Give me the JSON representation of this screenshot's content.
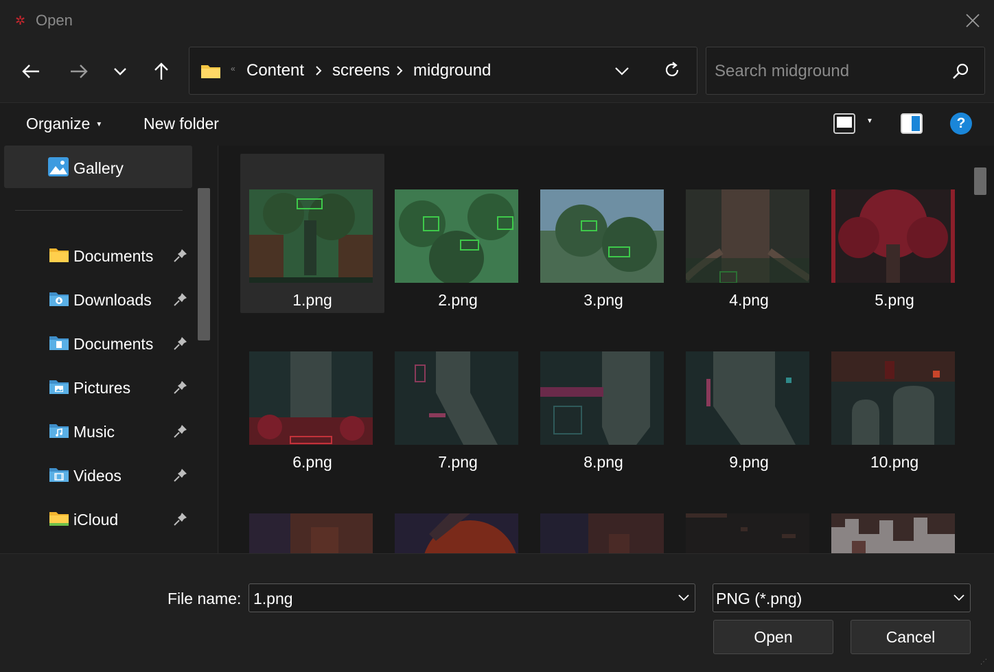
{
  "window": {
    "title": "Open"
  },
  "nav": {
    "breadcrumbs": [
      "Content",
      "screens",
      "midground"
    ],
    "search_placeholder": "Search midground"
  },
  "commands": {
    "organize": "Organize",
    "new_folder": "New folder",
    "help": "?"
  },
  "sidebar": {
    "gallery": "Gallery",
    "items": [
      {
        "label": "Documents",
        "icon": "folder-icon"
      },
      {
        "label": "Downloads",
        "icon": "downloads-folder-icon"
      },
      {
        "label": "Documents",
        "icon": "documents-folder-icon"
      },
      {
        "label": "Pictures",
        "icon": "pictures-folder-icon"
      },
      {
        "label": "Music",
        "icon": "music-folder-icon"
      },
      {
        "label": "Videos",
        "icon": "videos-folder-icon"
      },
      {
        "label": "iCloud",
        "icon": "icloud-folder-icon"
      }
    ]
  },
  "files": [
    {
      "name": "1.png",
      "selected": true
    },
    {
      "name": "2.png"
    },
    {
      "name": "3.png"
    },
    {
      "name": "4.png"
    },
    {
      "name": "5.png"
    },
    {
      "name": "6.png"
    },
    {
      "name": "7.png"
    },
    {
      "name": "8.png"
    },
    {
      "name": "9.png"
    },
    {
      "name": "10.png"
    },
    {
      "name": ""
    },
    {
      "name": ""
    },
    {
      "name": ""
    },
    {
      "name": ""
    },
    {
      "name": ""
    }
  ],
  "footer": {
    "file_name_label": "File name:",
    "file_name_value": "1.png",
    "file_type": "PNG (*.png)",
    "open": "Open",
    "cancel": "Cancel"
  },
  "colors": {
    "accent": "#1a86d9",
    "folder": "#f4c542",
    "folder_blue": "#5aa8d8"
  }
}
